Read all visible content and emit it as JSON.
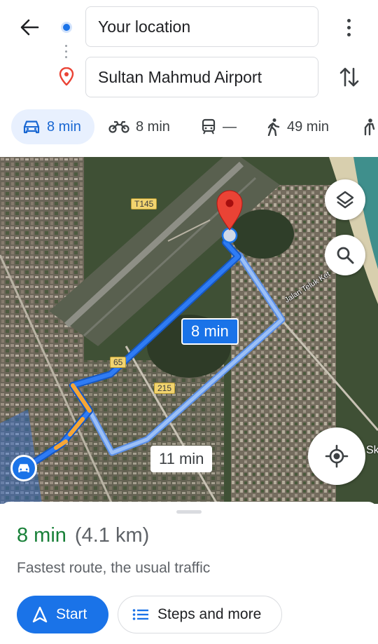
{
  "header": {
    "origin_value": "Your location",
    "destination_value": "Sultan Mahmud Airport"
  },
  "icons": {
    "back": "arrow-left-icon",
    "origin": "blue-dot-icon",
    "destination": "red-pin-icon",
    "more": "more-vert-icon",
    "swap": "swap-vert-icon",
    "drive": "car-icon",
    "motorcycle": "motorcycle-icon",
    "transit": "train-icon",
    "walk": "walk-icon",
    "ride": "ride-icon",
    "layers": "layers-icon",
    "search": "search-icon",
    "locate": "my-location-icon",
    "start": "navigation-icon",
    "steps": "list-icon"
  },
  "modes": {
    "drive": "8 min",
    "motorcycle": "8 min",
    "transit": "—",
    "walk": "49 min"
  },
  "map": {
    "road_labels": [
      "T145",
      "65",
      "215"
    ],
    "street_label": "Jalan Teluk Ket",
    "edge_label": "Sk",
    "primary_route_time": "8 min",
    "alt_route_time": "11 min"
  },
  "colors": {
    "accent": "#1a73e8",
    "route_primary": "#1a73e8",
    "route_alternate": "#8ab4f8",
    "traffic_slow": "#f6a636",
    "destination_pin": "#ea4335",
    "duration_green": "#188038"
  },
  "sheet": {
    "duration": "8 min",
    "distance": "(4.1 km)",
    "subtitle": "Fastest route, the usual traffic",
    "start_label": "Start",
    "steps_label": "Steps and more"
  }
}
